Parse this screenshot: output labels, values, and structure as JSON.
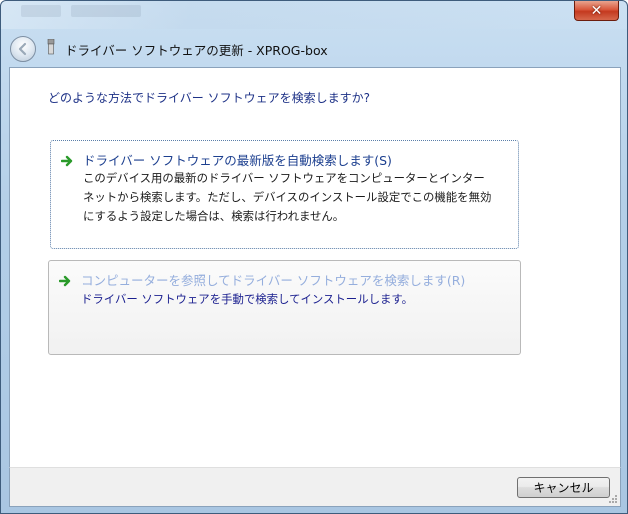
{
  "window": {
    "title": "ドライバー ソフトウェアの更新 - XPROG-box"
  },
  "dialog": {
    "question": "どのような方法でドライバー ソフトウェアを検索しますか?",
    "options": [
      {
        "title": "ドライバー ソフトウェアの最新版を自動検索します(S)",
        "desc_lines": [
          "このデバイス用の最新のドライバー ソフトウェアをコンピューターとインター",
          "ネットから検索します。ただし、デバイスのインストール設定でこの機能を無効",
          "にするよう設定した場合は、検索は行われません。"
        ]
      },
      {
        "title": "コンピューターを参照してドライバー ソフトウェアを検索します(R)",
        "desc_lines": [
          "ドライバー ソフトウェアを手動で検索してインストールします。"
        ]
      }
    ]
  },
  "footer": {
    "cancel_label": "キャンセル"
  },
  "colors": {
    "accent_green": "#2a9a2a",
    "link_blue": "#1e3287"
  }
}
